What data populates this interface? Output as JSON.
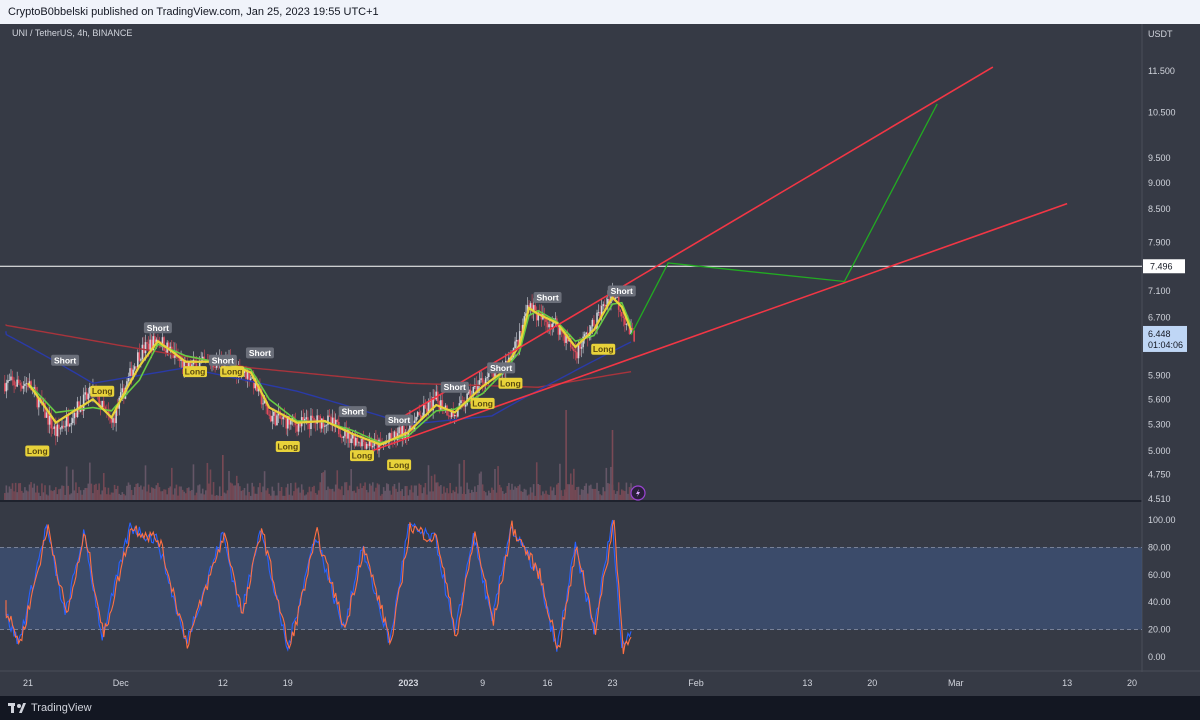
{
  "header": {
    "published_text": "CryptoB0bbelski published on TradingView.com, Jan 25, 2023 19:55 UTC+1"
  },
  "symbol": {
    "title": "UNI / TetherUS, 4h, BINANCE",
    "quote_currency": "USDT"
  },
  "price_pane": {
    "y_ticks": [
      "11.500",
      "10.500",
      "9.500",
      "9.000",
      "8.500",
      "7.900",
      "7.100",
      "6.700",
      "5.900",
      "5.600",
      "5.300",
      "5.000",
      "4.750",
      "4.510"
    ],
    "horizontal_line_label": "7.496",
    "current_price": "6.448",
    "countdown": "01:04:06"
  },
  "oscillator_pane": {
    "y_ticks": [
      "100.00",
      "80.00",
      "60.00",
      "40.00",
      "20.00",
      "0.00"
    ],
    "upper_band": 80,
    "lower_band": 20
  },
  "time_axis": {
    "labels": [
      "21",
      "Dec",
      "12",
      "19",
      "2023",
      "9",
      "16",
      "23",
      "Feb",
      "13",
      "20",
      "Mar",
      "13",
      "20"
    ]
  },
  "signals": {
    "short_label": "Short",
    "long_label": "Long"
  },
  "footer": {
    "brand": "TradingView"
  },
  "colors": {
    "background": "#363a45",
    "trendline": "#f23645",
    "projection": "#22ab22",
    "horizontal_line": "#ffffff",
    "candle_up": "#d1d4dc",
    "candle_down": "#e04a5a",
    "stoch_k": "#2962ff",
    "stoch_d": "#ff7043",
    "band_fill": "#3d5277"
  },
  "chart_data": {
    "type": "line",
    "symbol": "UNI / TetherUS",
    "interval": "4h",
    "exchange": "BINANCE",
    "x_range": [
      "2022-11-18",
      "2023-03-21"
    ],
    "ylim": [
      4.51,
      11.8
    ],
    "y_scale": "log",
    "price_path": [
      [
        "2022-11-21",
        5.8
      ],
      [
        "2022-11-24",
        5.2
      ],
      [
        "2022-11-28",
        5.7
      ],
      [
        "2022-11-30",
        5.3
      ],
      [
        "2022-12-03",
        6.2
      ],
      [
        "2022-12-05",
        6.4
      ],
      [
        "2022-12-08",
        6.0
      ],
      [
        "2022-12-12",
        6.1
      ],
      [
        "2022-12-15",
        5.9
      ],
      [
        "2022-12-17",
        5.4
      ],
      [
        "2022-12-20",
        5.3
      ],
      [
        "2022-12-23",
        5.35
      ],
      [
        "2022-12-26",
        5.15
      ],
      [
        "2022-12-29",
        5.05
      ],
      [
        "2023-01-01",
        5.25
      ],
      [
        "2023-01-04",
        5.6
      ],
      [
        "2023-01-06",
        5.4
      ],
      [
        "2023-01-09",
        5.85
      ],
      [
        "2023-01-11",
        5.95
      ],
      [
        "2023-01-13",
        6.4
      ],
      [
        "2023-01-14",
        6.95
      ],
      [
        "2023-01-15",
        6.7
      ],
      [
        "2023-01-17",
        6.6
      ],
      [
        "2023-01-19",
        6.2
      ],
      [
        "2023-01-21",
        6.6
      ],
      [
        "2023-01-23",
        7.1
      ],
      [
        "2023-01-24",
        6.8
      ],
      [
        "2023-01-25",
        6.448
      ]
    ],
    "ma_long_path": [
      [
        "2022-11-18",
        6.6
      ],
      [
        "2022-12-01",
        6.3
      ],
      [
        "2022-12-15",
        6.0
      ],
      [
        "2023-01-01",
        5.8
      ],
      [
        "2023-01-15",
        5.75
      ],
      [
        "2023-01-25",
        5.95
      ]
    ],
    "ma_mid_path": [
      [
        "2022-11-18",
        6.5
      ],
      [
        "2022-11-28",
        5.8
      ],
      [
        "2022-12-08",
        6.0
      ],
      [
        "2022-12-20",
        5.7
      ],
      [
        "2023-01-01",
        5.3
      ],
      [
        "2023-01-10",
        5.4
      ],
      [
        "2023-01-18",
        5.9
      ],
      [
        "2023-01-25",
        6.35
      ]
    ],
    "upper_trendline": [
      [
        "2022-12-30",
        5.3
      ],
      [
        "2023-03-05",
        11.6
      ]
    ],
    "lower_trendline": [
      [
        "2022-12-28",
        5.0
      ],
      [
        "2023-03-13",
        8.6
      ]
    ],
    "horizontal_level": 7.496,
    "projection_path": [
      [
        "2023-01-25",
        6.45
      ],
      [
        "2023-01-29",
        7.55
      ],
      [
        "2023-02-17",
        7.25
      ],
      [
        "2023-02-27",
        10.7
      ]
    ],
    "signals": [
      {
        "type": "Short",
        "date": "2022-11-25",
        "price": 6.1
      },
      {
        "type": "Long",
        "date": "2022-11-22",
        "price": 5.0
      },
      {
        "type": "Long",
        "date": "2022-11-29",
        "price": 5.7
      },
      {
        "type": "Short",
        "date": "2022-12-05",
        "price": 6.55
      },
      {
        "type": "Long",
        "date": "2022-12-09",
        "price": 5.95
      },
      {
        "type": "Long",
        "date": "2022-12-13",
        "price": 5.95
      },
      {
        "type": "Short",
        "date": "2022-12-12",
        "price": 6.1
      },
      {
        "type": "Short",
        "date": "2022-12-16",
        "price": 6.2
      },
      {
        "type": "Long",
        "date": "2022-12-19",
        "price": 5.05
      },
      {
        "type": "Short",
        "date": "2022-12-26",
        "price": 5.45
      },
      {
        "type": "Long",
        "date": "2022-12-27",
        "price": 4.95
      },
      {
        "type": "Short",
        "date": "2022-12-31",
        "price": 5.35
      },
      {
        "type": "Long",
        "date": "2022-12-31",
        "price": 4.85
      },
      {
        "type": "Short",
        "date": "2023-01-06",
        "price": 5.75
      },
      {
        "type": "Long",
        "date": "2023-01-09",
        "price": 5.55
      },
      {
        "type": "Short",
        "date": "2023-01-11",
        "price": 6.0
      },
      {
        "type": "Long",
        "date": "2023-01-12",
        "price": 5.8
      },
      {
        "type": "Short",
        "date": "2023-01-16",
        "price": 7.0
      },
      {
        "type": "Long",
        "date": "2023-01-22",
        "price": 6.25
      },
      {
        "type": "Short",
        "date": "2023-01-24",
        "price": 7.1
      }
    ],
    "stochastic": {
      "upper_band": 80,
      "lower_band": 20,
      "last_k": 22,
      "pivots": [
        [
          "2022-11-18",
          40
        ],
        [
          "2022-11-20",
          10
        ],
        [
          "2022-11-23",
          95
        ],
        [
          "2022-11-25",
          30
        ],
        [
          "2022-11-27",
          90
        ],
        [
          "2022-11-29",
          15
        ],
        [
          "2022-12-02",
          95
        ],
        [
          "2022-12-05",
          85
        ],
        [
          "2022-12-08",
          10
        ],
        [
          "2022-12-12",
          90
        ],
        [
          "2022-12-14",
          30
        ],
        [
          "2022-12-16",
          95
        ],
        [
          "2022-12-19",
          5
        ],
        [
          "2022-12-22",
          90
        ],
        [
          "2022-12-25",
          20
        ],
        [
          "2022-12-27",
          80
        ],
        [
          "2022-12-30",
          10
        ],
        [
          "2023-01-01",
          95
        ],
        [
          "2023-01-04",
          85
        ],
        [
          "2023-01-06",
          15
        ],
        [
          "2023-01-08",
          90
        ],
        [
          "2023-01-10",
          25
        ],
        [
          "2023-01-12",
          95
        ],
        [
          "2023-01-15",
          60
        ],
        [
          "2023-01-17",
          5
        ],
        [
          "2023-01-19",
          80
        ],
        [
          "2023-01-21",
          20
        ],
        [
          "2023-01-23",
          100
        ],
        [
          "2023-01-24",
          5
        ],
        [
          "2023-01-25",
          22
        ]
      ]
    }
  }
}
